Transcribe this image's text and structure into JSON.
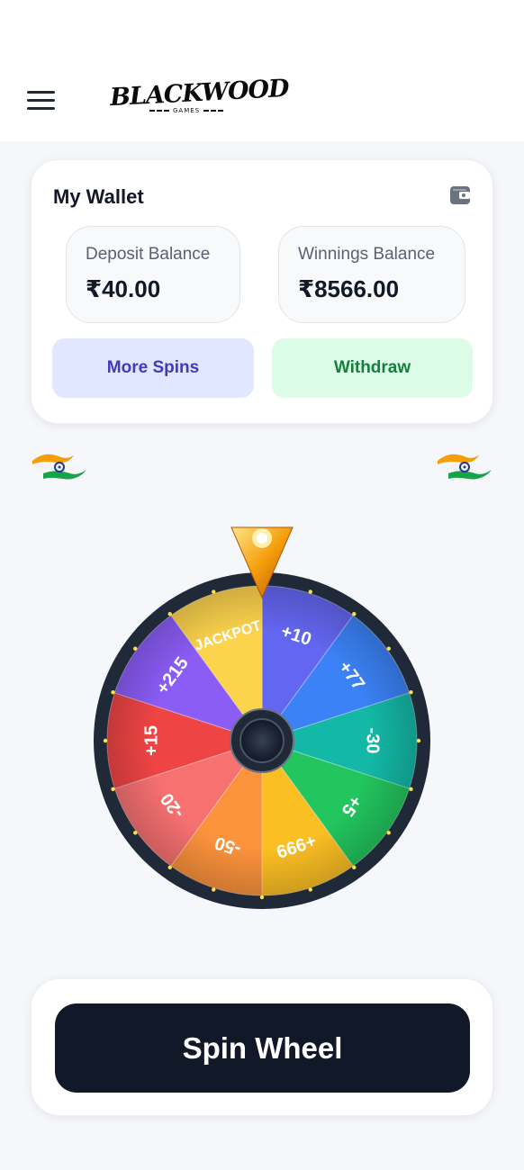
{
  "header": {
    "logo_title": "BLACKWOOD",
    "logo_subtitle": "GAMES"
  },
  "wallet": {
    "title": "My Wallet",
    "deposit_label": "Deposit Balance",
    "deposit_value": "₹40.00",
    "winnings_label": "Winnings Balance",
    "winnings_value": "₹8566.00",
    "more_spins_label": "More Spins",
    "withdraw_label": "Withdraw"
  },
  "wheel": {
    "segments": [
      {
        "label": "+10",
        "color": "#6366f1"
      },
      {
        "label": "+77",
        "color": "#3b82f6"
      },
      {
        "label": "-30",
        "color": "#14b8a6"
      },
      {
        "label": "+5",
        "color": "#22c55e"
      },
      {
        "label": "+999",
        "color": "#fbbf24"
      },
      {
        "label": "-50",
        "color": "#fb923c"
      },
      {
        "label": "-20",
        "color": "#f87171"
      },
      {
        "label": "+15",
        "color": "#ef4444"
      },
      {
        "label": "+215",
        "color": "#8b5cf6"
      },
      {
        "label": "JACKPOT",
        "color": "#fcd34d"
      }
    ]
  },
  "spin": {
    "button_label": "Spin Wheel"
  },
  "colors": {
    "primary_dark": "#111827",
    "spins_bg": "#e0e7ff",
    "spins_text": "#3f3cbb",
    "withdraw_bg": "#dcfce7",
    "withdraw_text": "#15803d"
  },
  "icons": {
    "menu": "hamburger-icon",
    "wallet": "wallet-icon",
    "flag": "india-flag-icon",
    "pointer": "pointer-icon"
  }
}
